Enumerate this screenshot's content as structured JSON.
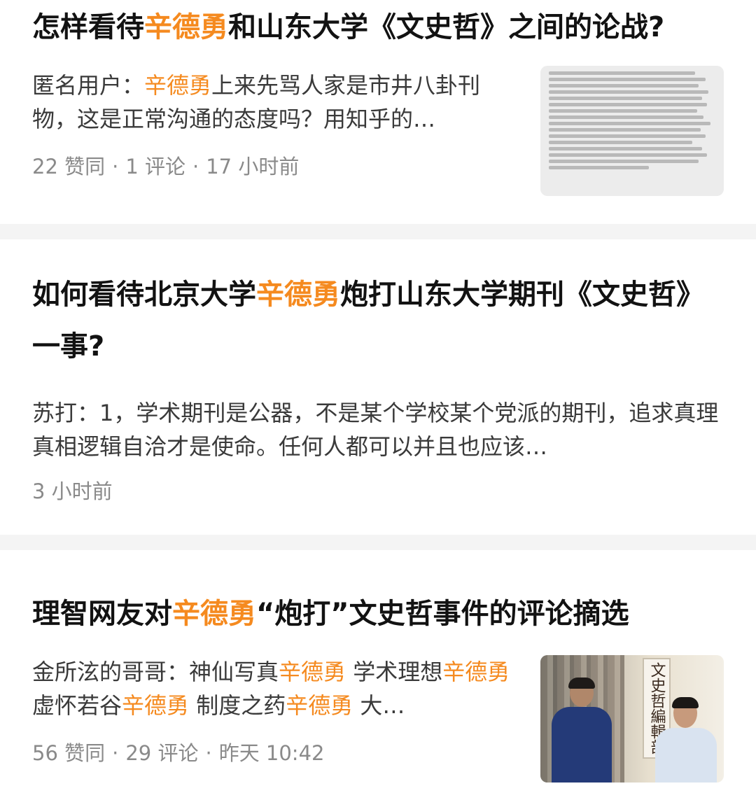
{
  "results": [
    {
      "title_parts": [
        {
          "text": "怎样看待",
          "hl": false
        },
        {
          "text": "辛德勇",
          "hl": true
        },
        {
          "text": "和山东大学《文史哲》之间的论战?",
          "hl": false
        }
      ],
      "excerpt_parts": [
        {
          "text": "匿名用户：",
          "hl": false
        },
        {
          "text": "辛德勇",
          "hl": true
        },
        {
          "text": "上来先骂人家是市井八卦刊物，这是正常沟通的态度吗？用知乎的…",
          "hl": false
        }
      ],
      "meta": {
        "votes": "22 赞同",
        "comments": "1 评论",
        "time": "17 小时前"
      },
      "thumbnail": "document-scan-thumbnail"
    },
    {
      "title_parts": [
        {
          "text": "如何看待北京大学",
          "hl": false
        },
        {
          "text": "辛德勇",
          "hl": true
        },
        {
          "text": "炮打山东大学期刊《文史哲》一事?",
          "hl": false
        }
      ],
      "excerpt_parts": [
        {
          "text": "苏打：1，学术期刊是公器，不是某个学校某个党派的期刊，追求真理真相逻辑自洽才是使命。任何人都可以并且也应该…",
          "hl": false
        }
      ],
      "meta": {
        "time": "3 小时前"
      }
    },
    {
      "title_parts": [
        {
          "text": "理智网友对",
          "hl": false
        },
        {
          "text": "辛德勇",
          "hl": true
        },
        {
          "text": "“炮打”文史哲事件的评论摘选",
          "hl": false
        }
      ],
      "excerpt_parts": [
        {
          "text": "金所泫的哥哥：神仙写真",
          "hl": false
        },
        {
          "text": "辛德勇",
          "hl": true
        },
        {
          "text": " 学术理想",
          "hl": false
        },
        {
          "text": "辛德勇",
          "hl": true
        },
        {
          "text": " 虚怀若谷",
          "hl": false
        },
        {
          "text": "辛德勇",
          "hl": true
        },
        {
          "text": " 制度之药",
          "hl": false
        },
        {
          "text": "辛德勇",
          "hl": true
        },
        {
          "text": " 大…",
          "hl": false
        }
      ],
      "meta": {
        "votes": "56 赞同",
        "comments": "29 评论",
        "time": "昨天 10:42"
      },
      "thumbnail": "two-men-photo-thumbnail",
      "thumbnail_sign": "文史哲編輯部"
    }
  ],
  "colors": {
    "highlight": "#f58a1f",
    "meta": "#8a8a8a",
    "divider": "#f4f4f4"
  }
}
